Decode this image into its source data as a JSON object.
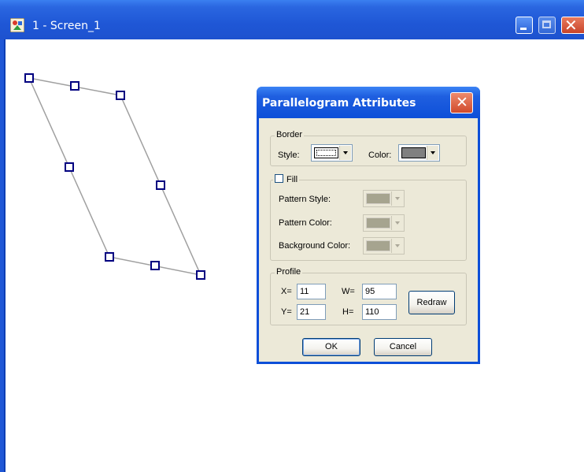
{
  "window": {
    "title": "1 - Screen_1"
  },
  "dialog": {
    "title": "Parallelogram Attributes",
    "border": {
      "legend": "Border",
      "style_label": "Style:",
      "color_label": "Color:",
      "color_value": "#808080"
    },
    "fill": {
      "legend": "Fill",
      "checked": false,
      "pattern_style_label": "Pattern Style:",
      "pattern_color_label": "Pattern Color:",
      "background_color_label": "Background Color:"
    },
    "profile": {
      "legend": "Profile",
      "x_label": "X=",
      "x_value": "11",
      "y_label": "Y=",
      "y_value": "21",
      "w_label": "W=",
      "w_value": "95",
      "h_label": "H=",
      "h_value": "110",
      "redraw_label": "Redraw"
    },
    "ok_label": "OK",
    "cancel_label": "Cancel"
  },
  "colors": {
    "titlebar": "#1f57d6",
    "dialog_bg": "#ece9d8",
    "handle": "#000080",
    "shape_line": "#a0a0a0"
  }
}
